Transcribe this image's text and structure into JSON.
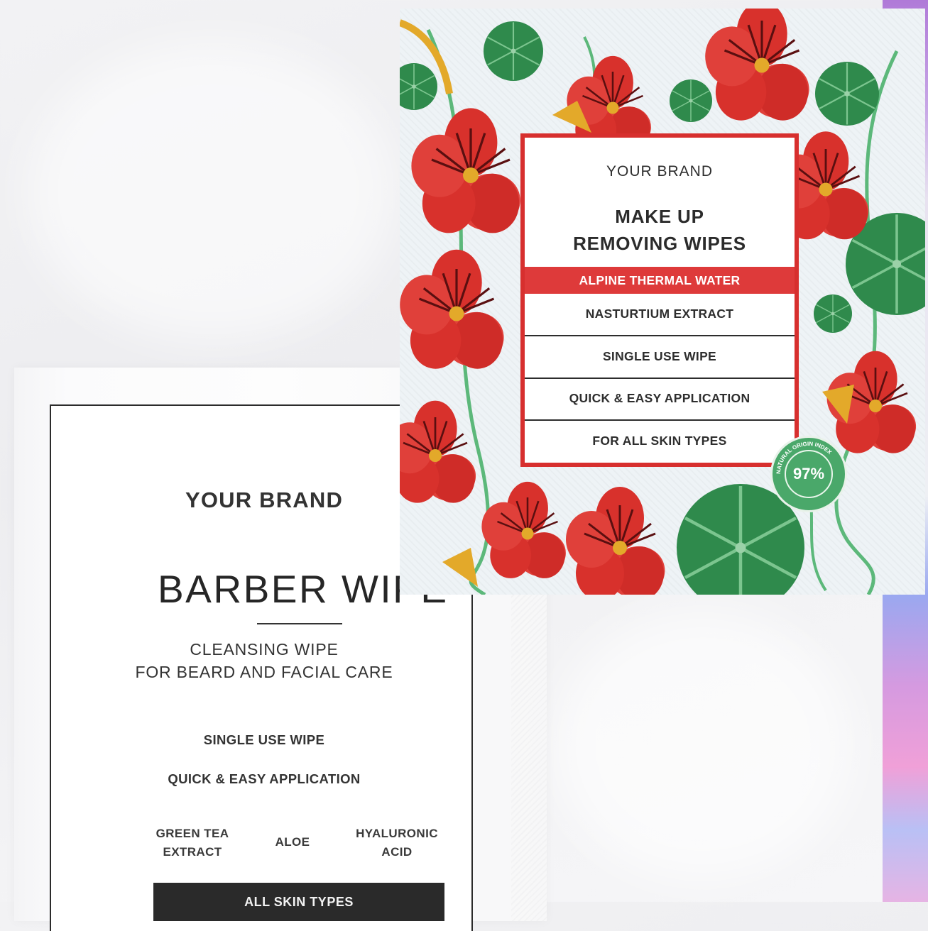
{
  "barber_pack": {
    "brand": "YOUR BRAND",
    "title": "BARBER WIPE",
    "subtitle_line1": "CLEANSING WIPE",
    "subtitle_line2": "FOR BEARD AND FACIAL CARE",
    "features": [
      "SINGLE USE WIPE",
      "QUICK & EASY APPLICATION"
    ],
    "ingredients": [
      "GREEN TEA\nEXTRACT",
      "ALOE",
      "HYALURONIC\nACID"
    ],
    "bar_label": "ALL SKIN TYPES"
  },
  "nasturtium_pack": {
    "brand": "YOUR BRAND",
    "title_line1": "MAKE UP",
    "title_line2": "REMOVING WIPES",
    "highlight": "ALPINE THERMAL WATER",
    "rows": [
      "NASTURTIUM EXTRACT",
      "SINGLE USE WIPE",
      "QUICK & EASY APPLICATION",
      "FOR ALL SKIN TYPES"
    ],
    "badge_value": "97%",
    "badge_ring_text": "NATURAL ORIGIN INDEX",
    "colors": {
      "flower_red": "#d8312c",
      "leaf_green": "#2f8a4c",
      "stem_green": "#5cb87a",
      "panel_border": "#d72f2e",
      "accent_yellow": "#e3a92a"
    }
  }
}
